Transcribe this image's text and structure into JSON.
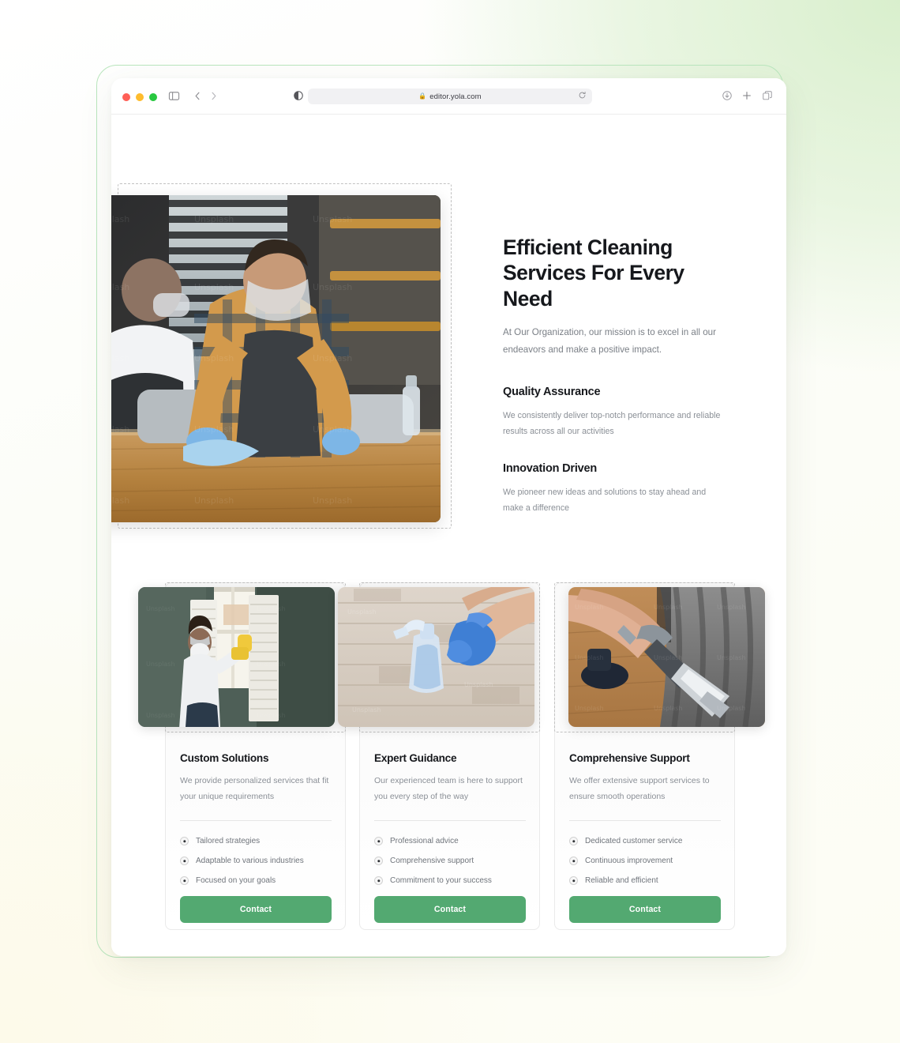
{
  "browser": {
    "url": "editor.yola.com",
    "lock_icon": "lock-icon",
    "icons": {
      "sidebar": "sidebar-toggle-icon",
      "back": "chevron-left-icon",
      "forward": "chevron-right-icon",
      "reader": "reader-view-icon",
      "reload": "reload-icon",
      "download": "download-icon",
      "new_tab": "plus-icon",
      "tab_overview": "tab-overview-icon"
    }
  },
  "hero": {
    "title": "Efficient Cleaning Services For Every Need",
    "subtitle": "At Our Organization, our mission is to excel in all our endeavors and make a positive impact.",
    "image_alt": "worker in plaid shirt and face shield wiping a wooden restaurant table",
    "features": [
      {
        "heading": "Quality Assurance",
        "text": "We consistently deliver top-notch performance and reliable results across all our activities"
      },
      {
        "heading": "Innovation Driven",
        "text": "We pioneer new ideas and solutions to stay ahead and make a difference"
      }
    ]
  },
  "cards": [
    {
      "title": "Custom Solutions",
      "description": "We provide personalized services that fit your unique requirements",
      "image_alt": "woman in mask cleaning window shutters with yellow gloves",
      "bullets": [
        "Tailored strategies",
        "Adaptable to various industries",
        "Focused on your goals"
      ],
      "button": "Contact"
    },
    {
      "title": "Expert Guidance",
      "description": "Our experienced team is here to support you every step of the way",
      "image_alt": "gloved hand holding a blue spray bottle over a wooden plank floor",
      "bullets": [
        "Professional advice",
        "Comprehensive support",
        "Commitment to your success"
      ],
      "button": "Contact"
    },
    {
      "title": "Comprehensive Support",
      "description": "We offer extensive support services to ensure smooth operations",
      "image_alt": "person using an extraction wand to deep clean a grey sofa",
      "bullets": [
        "Dedicated customer service",
        "Continuous improvement",
        "Reliable and efficient"
      ],
      "button": "Contact"
    }
  ],
  "colors": {
    "accent_green": "#53a971",
    "heading": "#16181c",
    "body_text": "#8a8f96",
    "frame_outline": "#b9e6bd"
  }
}
